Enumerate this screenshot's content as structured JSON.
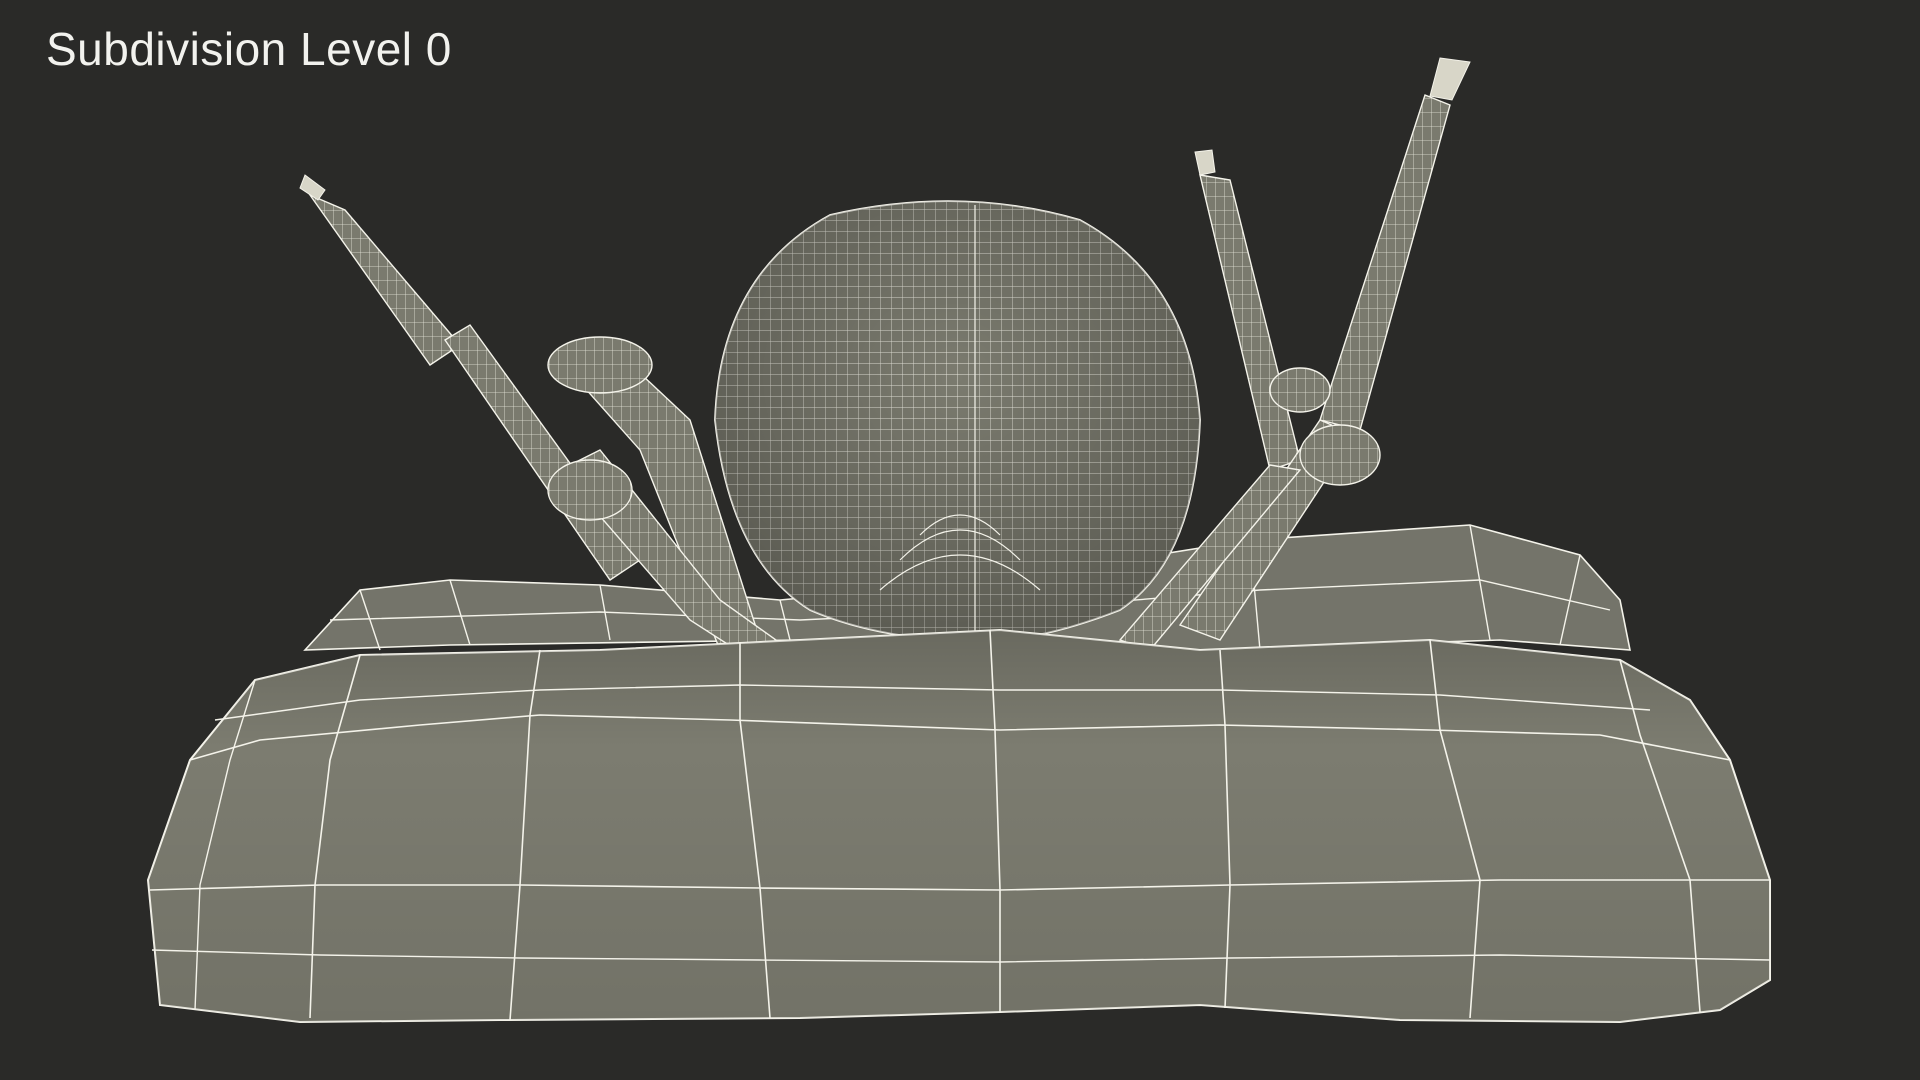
{
  "caption": "Subdivision Level 0",
  "colors": {
    "background": "#2a2a28",
    "mesh_fill": "#7b7b6f",
    "mesh_shadow": "#5e5e55",
    "wireframe": "#f4f3ea",
    "caption_text": "#f2f2ee"
  }
}
